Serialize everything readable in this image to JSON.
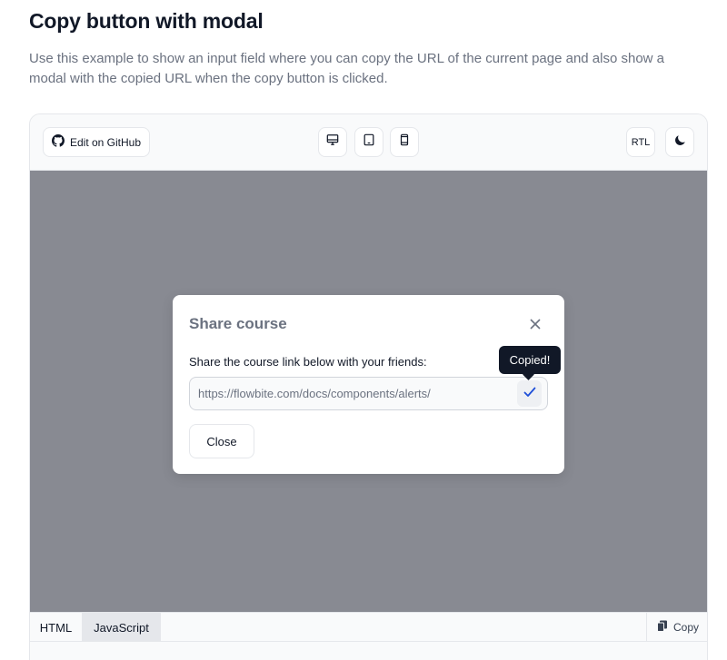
{
  "page": {
    "title": "Copy button with modal",
    "description": "Use this example to show an input field where you can copy the URL of the current page and also show a modal with the copied URL when the copy button is clicked."
  },
  "toolbar": {
    "github_label": "Edit on GitHub",
    "devices": [
      "desktop-icon",
      "tablet-icon",
      "mobile-icon"
    ],
    "rtl_label": "RTL",
    "dark_mode_icon": "moon-icon"
  },
  "modal": {
    "title": "Share course",
    "label": "Share the course link below with your friends:",
    "url_value": "https://flowbite.com/docs/components/alerts/",
    "tooltip": "Copied!",
    "close_label": "Close"
  },
  "code_bar": {
    "tabs": [
      "HTML",
      "JavaScript"
    ],
    "active_tab": "JavaScript",
    "copy_label": "Copy"
  },
  "colors": {
    "backdrop": "#888a92",
    "accent": "#1d4ed8",
    "tooltip_bg": "#111827"
  }
}
